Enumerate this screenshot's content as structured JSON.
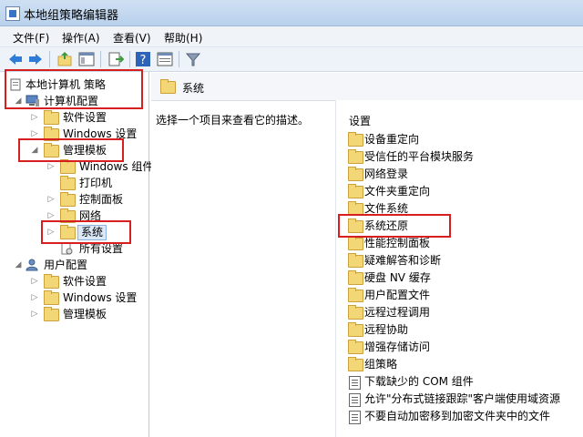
{
  "window": {
    "title": "本地组策略编辑器"
  },
  "menu": [
    "文件(F)",
    "操作(A)",
    "查看(V)",
    "帮助(H)"
  ],
  "toolbar_icons": [
    "back-arrow-icon",
    "forward-arrow-icon",
    "up-folder-icon",
    "show-hide-tree-icon",
    "export-list-icon",
    "help-icon",
    "properties-icon",
    "filter-icon"
  ],
  "tree": {
    "root": "本地计算机 策略",
    "computer_config": "计算机配置",
    "software_settings": "软件设置",
    "windows_settings": "Windows 设置",
    "admin_templates": "管理模板",
    "windows_components": "Windows 组件",
    "printers": "打印机",
    "control_panel": "控制面板",
    "network": "网络",
    "system": "系统",
    "all_settings": "所有设置",
    "user_config": "用户配置",
    "user_software_settings": "软件设置",
    "user_windows_settings": "Windows 设置",
    "user_admin_templates": "管理模板"
  },
  "right_panel": {
    "header": "系统",
    "description": "选择一个项目来查看它的描述。",
    "column_header": "设置",
    "items": [
      {
        "label": "设备重定向",
        "type": "folder"
      },
      {
        "label": "受信任的平台模块服务",
        "type": "folder"
      },
      {
        "label": "网络登录",
        "type": "folder"
      },
      {
        "label": "文件夹重定向",
        "type": "folder"
      },
      {
        "label": "文件系统",
        "type": "folder"
      },
      {
        "label": "系统还原",
        "type": "folder"
      },
      {
        "label": "性能控制面板",
        "type": "folder"
      },
      {
        "label": "疑难解答和诊断",
        "type": "folder"
      },
      {
        "label": "硬盘 NV 缓存",
        "type": "folder"
      },
      {
        "label": "用户配置文件",
        "type": "folder"
      },
      {
        "label": "远程过程调用",
        "type": "folder"
      },
      {
        "label": "远程协助",
        "type": "folder"
      },
      {
        "label": "增强存储访问",
        "type": "folder"
      },
      {
        "label": "组策略",
        "type": "folder"
      },
      {
        "label": "下载缺少的 COM 组件",
        "type": "setting"
      },
      {
        "label": "允许\"分布式链接跟踪\"客户端使用域资源",
        "type": "setting"
      },
      {
        "label": "不要自动加密移到加密文件夹中的文件",
        "type": "setting"
      }
    ]
  },
  "colors": {
    "highlight": "#d81f1f",
    "folder": "#f3d676"
  }
}
